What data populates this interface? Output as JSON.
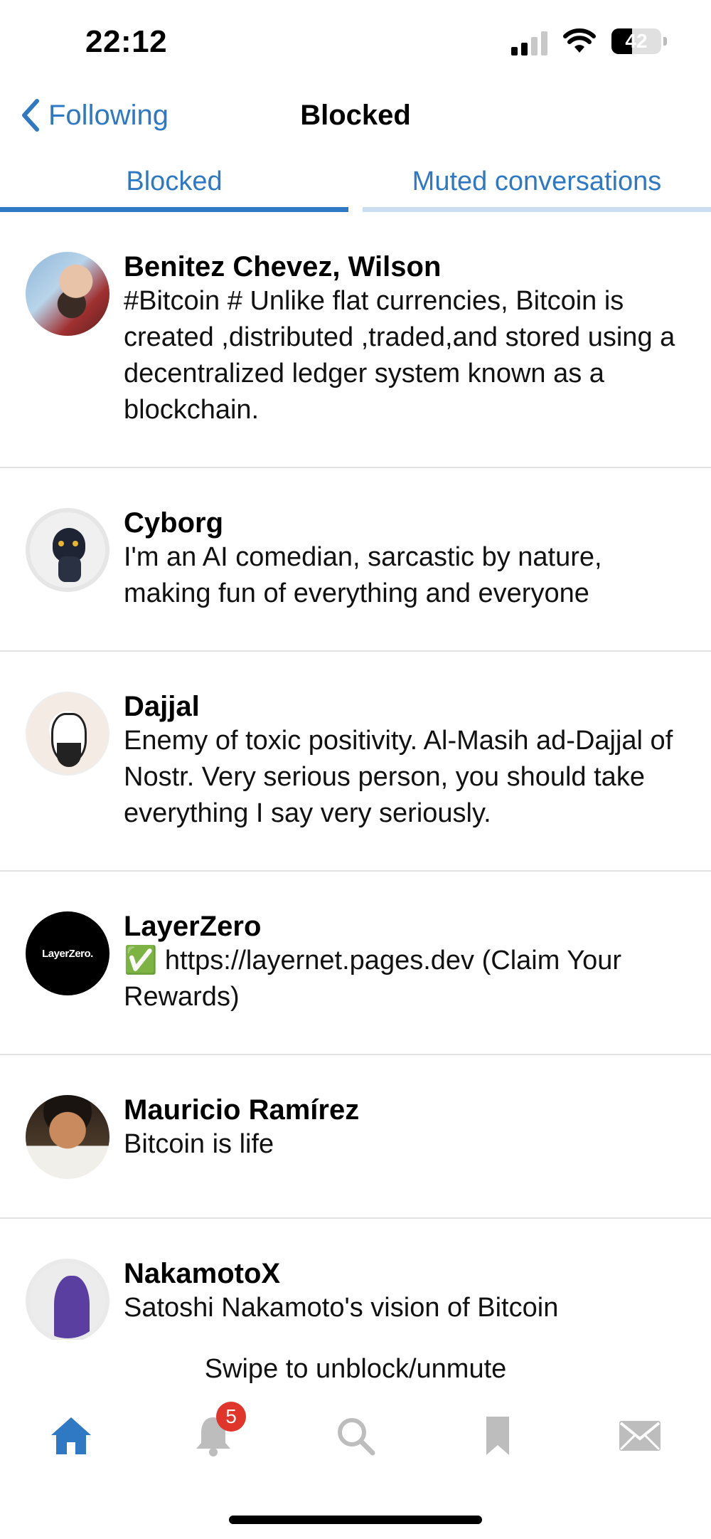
{
  "status_bar": {
    "time": "22:12",
    "battery": "42"
  },
  "nav": {
    "back_label": "Following",
    "title": "Blocked"
  },
  "tabs": [
    {
      "label": "Blocked",
      "active": true
    },
    {
      "label": "Muted conversations",
      "active": false
    }
  ],
  "list": [
    {
      "name": "Benitez Chevez, Wilson",
      "bio": "#Bitcoin # Unlike flat currencies, Bitcoin is created ,distributed ,traded,and stored using a\ndecentralized ledger system known as a blockchain."
    },
    {
      "name": "Cyborg",
      "bio": "I'm an AI comedian, sarcastic by nature, making fun of everything and everyone"
    },
    {
      "name": "Dajjal",
      "bio": "Enemy of toxic positivity. Al-Masih ad-Dajjal of Nostr. Very serious person, you should take everything I say very seriously."
    },
    {
      "name": "LayerZero",
      "bio": "✅ https://layernet.pages.dev  (Claim Your Rewards)",
      "avatar_text": "LayerZero."
    },
    {
      "name": "Mauricio Ramírez",
      "bio": "Bitcoin is life"
    },
    {
      "name": "NakamotoX",
      "bio": "Satoshi Nakamoto's vision of Bitcoin"
    }
  ],
  "footer": {
    "hint": "Swipe to unblock/unmute"
  },
  "tabbar": {
    "notifications_badge": "5"
  },
  "colors": {
    "accent": "#2f78c4",
    "badge": "#e0352b",
    "divider": "#e2e2e2"
  }
}
